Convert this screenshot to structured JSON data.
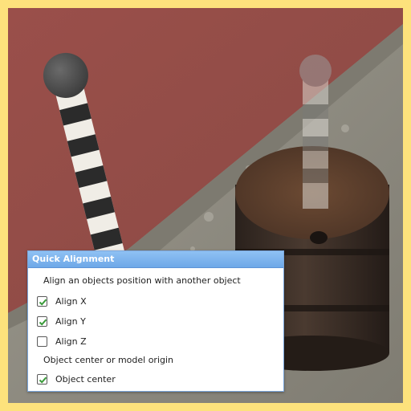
{
  "panel": {
    "title": "Quick Alignment",
    "description": "Align an objects position with another object",
    "options": [
      {
        "label": "Align X",
        "checked": true
      },
      {
        "label": "Align Y",
        "checked": true
      },
      {
        "label": "Align Z",
        "checked": false
      }
    ],
    "section_label": "Object center or model origin",
    "object_center": {
      "label": "Object center",
      "checked": true
    }
  },
  "colors": {
    "frame": "#fde27c",
    "title_bar": "#7ab2ee",
    "check": "#3a9b3a"
  }
}
